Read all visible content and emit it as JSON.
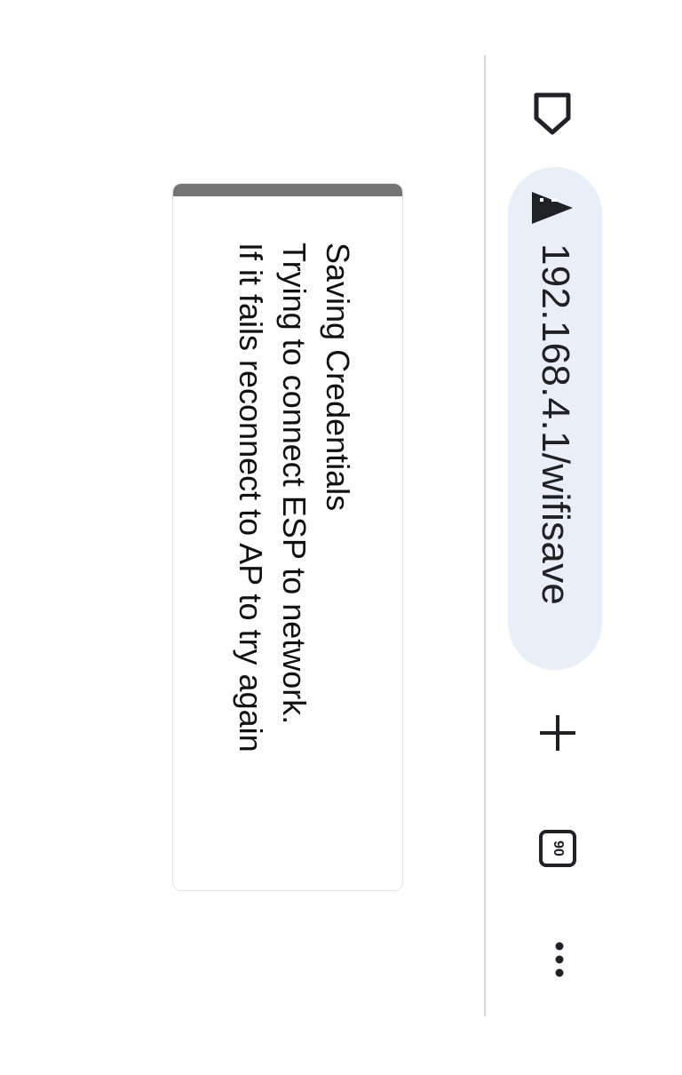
{
  "toolbar": {
    "home_icon": "home-icon",
    "security_icon": "warning-triangle-icon",
    "url": "192.168.4.1/wifisave",
    "new_tab_icon": "plus-icon",
    "tab_count": "90",
    "menu_icon": "more-dots-icon"
  },
  "page": {
    "lines": [
      "Saving Credentials",
      "Trying to connect ESP to network.",
      "If it fails reconnect to AP to try again"
    ]
  },
  "colors": {
    "url_pill": "#e9eef8",
    "card_bar": "#757575",
    "icon": "#202124"
  }
}
